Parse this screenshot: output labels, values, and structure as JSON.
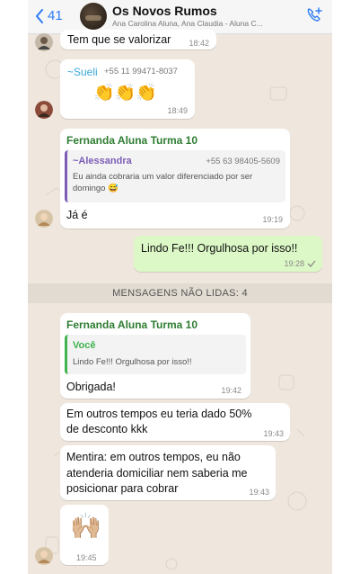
{
  "header": {
    "back_count": "41",
    "group_title": "Os Novos Rumos",
    "members": "Ana Carolina Aluna, Ana Claudia - Aluna C..."
  },
  "messages": [
    {
      "text": "Tem que se valorizar",
      "time": "18:42"
    },
    {
      "sender": "~Sueli",
      "phone": "+55 11 99471-8037",
      "emoji": "👏👏👏",
      "time": "18:49"
    },
    {
      "sender": "Fernanda Aluna Turma 10",
      "quote_name": "~Alessandra",
      "quote_phone": "+55 63 98405-5609",
      "quote_text_1": "Eu ainda cobraria um valor diferenciado por ser",
      "quote_text_2": "domingo 😅",
      "text": "Já é",
      "time": "19:19"
    },
    {
      "text": "Lindo Fe!!! Orgulhosa por isso!!",
      "time": "19:28"
    }
  ],
  "unread_label": "MENSAGENS NÃO LIDAS: 4",
  "unread_messages": [
    {
      "sender": "Fernanda Aluna Turma 10",
      "quote_name": "Você",
      "quote_text": "Lindo Fe!!! Orgulhosa por isso!!",
      "text": "Obrigada!",
      "time": "19:42"
    },
    {
      "text_1": "Em outros tempos eu teria dado 50%",
      "text_2": "de desconto kkk",
      "time": "19:43"
    },
    {
      "text_1": "Mentira: em outros tempos, eu não",
      "text_2": "atenderia domiciliar nem saberia me",
      "text_3": "posicionar para cobrar",
      "time": "19:43"
    },
    {
      "emoji": "🙌🏼",
      "time": "19:45"
    }
  ]
}
